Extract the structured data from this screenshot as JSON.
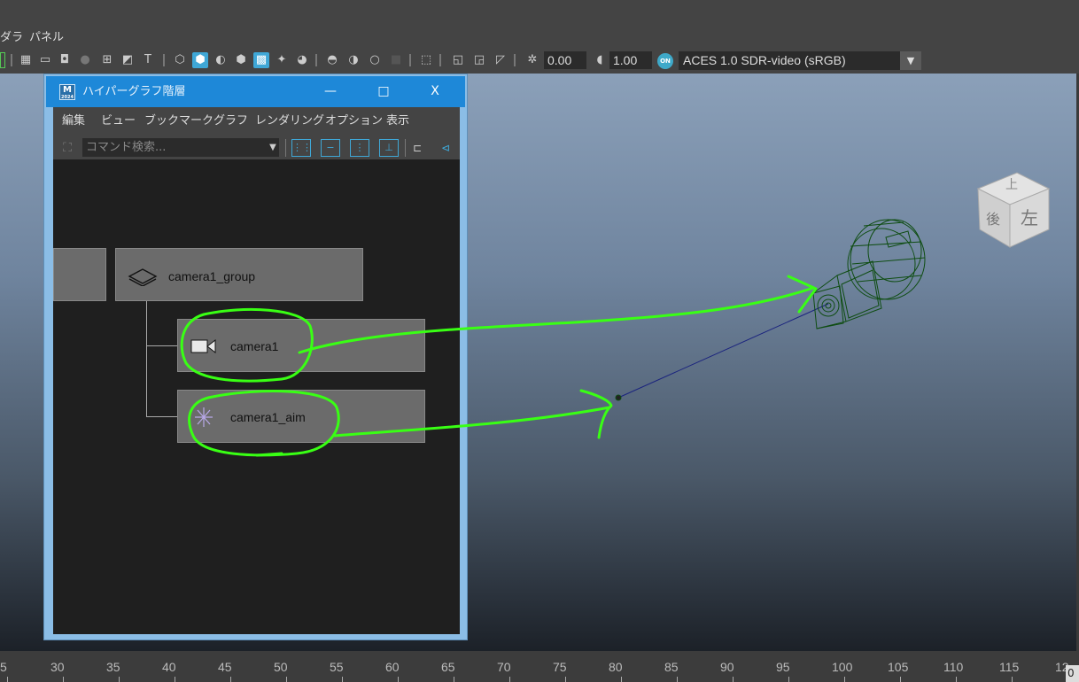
{
  "app_menu": {
    "item_partial": "ダラ",
    "item_panel": "パネル"
  },
  "viewport_toolbar": {
    "exposure_value": "0.00",
    "gamma_value": "1.00",
    "on_badge": "ON",
    "color_space": "ACES 1.0 SDR-video (sRGB)"
  },
  "view_cube": {
    "face_top": "上",
    "face_left": "左",
    "face_back": "後"
  },
  "hypergraph": {
    "window_title": "ハイパーグラフ階層",
    "logo_text": "M",
    "logo_sub": "2024",
    "minimize": "—",
    "maximize": "□",
    "close": "X",
    "menus": [
      "編集",
      "ビュー",
      "ブックマーク",
      "グラフ",
      "レンダリング",
      "オプション",
      "表示"
    ],
    "search_placeholder": "コマンド検索...",
    "nodes": {
      "group": "camera1_group",
      "camera": "camera1",
      "aim": "camera1_aim"
    }
  },
  "timeline": {
    "ticks": [
      "5",
      "30",
      "35",
      "40",
      "45",
      "50",
      "55",
      "60",
      "65",
      "70",
      "75",
      "80",
      "85",
      "90",
      "95",
      "100",
      "105",
      "110",
      "115",
      "12"
    ],
    "corner": "0"
  },
  "colors": {
    "titlebar": "#1e88d8",
    "annotation": "#39ff14",
    "wire": "#0f4d12",
    "aim_line": "#1a237e",
    "accent": "#3fa7d6"
  }
}
